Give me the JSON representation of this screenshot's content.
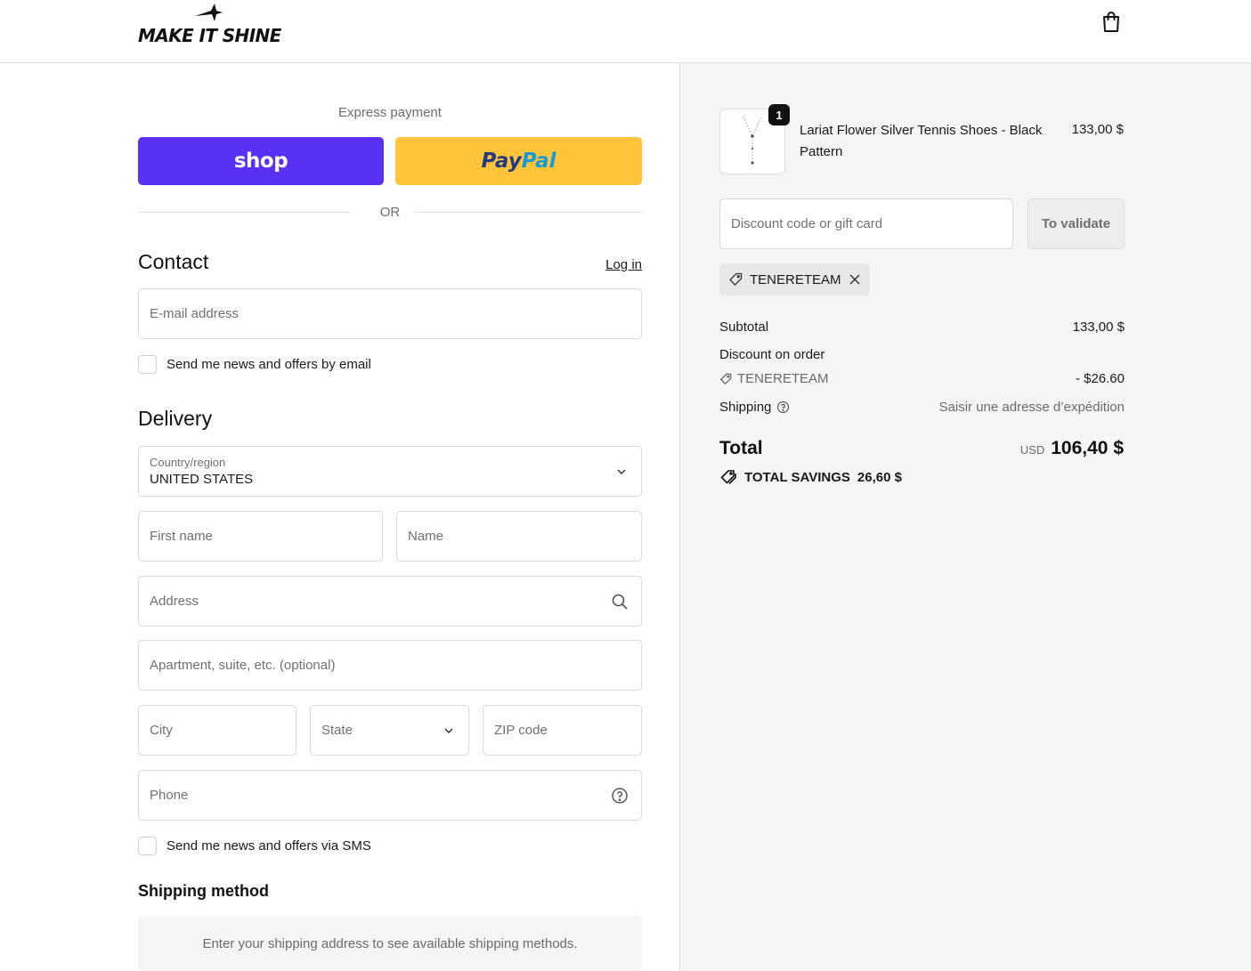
{
  "header": {
    "logo_text": "MAKE IT SHINE",
    "cart_icon": "shopping-bag-icon"
  },
  "express": {
    "label": "Express payment",
    "shop_label": "shop",
    "paypal_part1": "Pay",
    "paypal_part2": "Pal",
    "or_label": "OR"
  },
  "contact": {
    "title": "Contact",
    "login_label": "Log in",
    "email_placeholder": "E-mail address",
    "news_label": "Send me news and offers by email"
  },
  "delivery": {
    "title": "Delivery",
    "country_label": "Country/region",
    "country_value": "UNITED STATES",
    "first_name_placeholder": "First name",
    "name_placeholder": "Name",
    "address_placeholder": "Address",
    "apartment_placeholder": "Apartment, suite, etc. (optional)",
    "city_placeholder": "City",
    "state_placeholder": "State",
    "zip_placeholder": "ZIP code",
    "phone_placeholder": "Phone",
    "sms_label": "Send me news and offers via SMS"
  },
  "shipping_method": {
    "title": "Shipping method",
    "message": "Enter your shipping address to see available shipping methods."
  },
  "order": {
    "product": {
      "name": "Lariat Flower Silver Tennis Shoes - Black Pattern",
      "price": "133,00 $",
      "quantity": "1"
    },
    "discount_placeholder": "Discount code or gift card",
    "validate_label": "To validate",
    "applied_code": "TENERETEAM",
    "subtotal_label": "Subtotal",
    "subtotal_value": "133,00 $",
    "discount_label": "Discount on order",
    "discount_code": "TENERETEAM",
    "discount_value": "- $26.60",
    "shipping_label": "Shipping",
    "shipping_value": "Saisir une adresse d’expédition",
    "total_label": "Total",
    "total_currency": "USD",
    "total_value": "106,40 $",
    "savings_label": "TOTAL SAVINGS",
    "savings_value": "26,60 $"
  },
  "colors": {
    "shop_pay": "#5a31f4",
    "paypal": "#ffc439",
    "paypal_dark": "#253b80",
    "paypal_light": "#179bd7",
    "summary_bg": "#f5f5f5"
  }
}
